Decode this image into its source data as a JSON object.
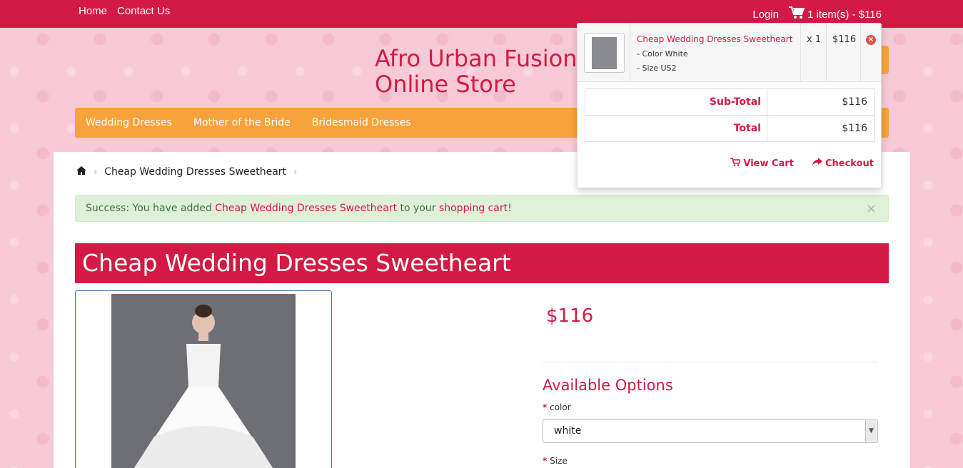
{
  "topbar": {
    "nav": [
      "Home",
      "Contact Us"
    ],
    "login": "Login",
    "cart_summary": "1 item(s) - $116"
  },
  "header": {
    "store_title_line1": "Afro Urban Fusion",
    "store_title_line2": "Online Store"
  },
  "menu": [
    "Wedding Dresses",
    "Mother of the Bride",
    "Bridesmaid Dresses"
  ],
  "breadcrumb": {
    "current": "Cheap Wedding Dresses Sweetheart"
  },
  "alert": {
    "prefix": "Success: You have added ",
    "product": "Cheap Wedding Dresses Sweetheart",
    "middle": " to your ",
    "cart": "shopping cart",
    "suffix": "!",
    "close": "×"
  },
  "product": {
    "title": "Cheap Wedding Dresses Sweetheart",
    "price": "$116",
    "options_title": "Available Options",
    "color_label": "color",
    "color_value": "white",
    "size_label": "Size",
    "required_mark": "*"
  },
  "cart_dropdown": {
    "item_name": "Cheap Wedding Dresses Sweetheart",
    "item_color": "- Color White",
    "item_size": "- Size US2",
    "qty": "x 1",
    "item_price": "$116",
    "subtotal_label": "Sub-Total",
    "subtotal_value": "$116",
    "total_label": "Total",
    "total_value": "$116",
    "view_cart": "View Cart",
    "checkout": "Checkout"
  },
  "colors": {
    "brand": "#d21a44",
    "menu": "#f7a23b",
    "background": "#f8c9d6"
  }
}
